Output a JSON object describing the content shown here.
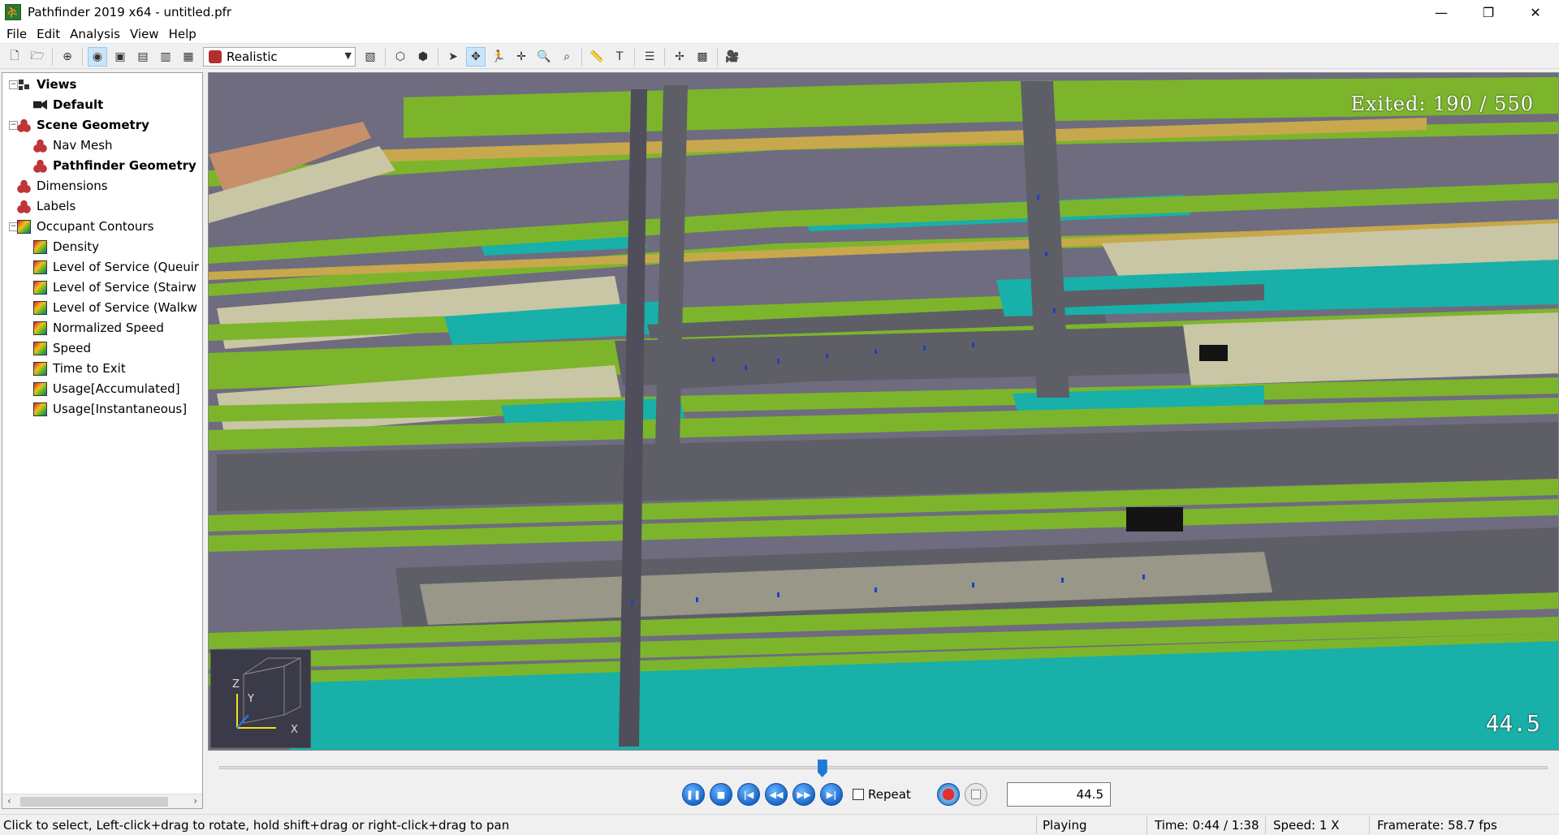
{
  "window": {
    "title": "Pathfinder 2019 x64 - untitled.pfr",
    "app_icon": "pathfinder-runner-icon",
    "minimize": "—",
    "restore": "❐",
    "close": "✕"
  },
  "menu": [
    "File",
    "Edit",
    "Analysis",
    "View",
    "Help"
  ],
  "toolbar": {
    "render_mode": "Realistic"
  },
  "tree": {
    "items": [
      {
        "label": "Views",
        "icon": "views-icon",
        "bold": true
      },
      {
        "label": "Default",
        "icon": "camera-icon",
        "bold": true
      },
      {
        "label": "Scene Geometry",
        "icon": "geometry-icon",
        "bold": true
      },
      {
        "label": "Nav Mesh",
        "icon": "geometry-icon",
        "bold": false
      },
      {
        "label": "Pathfinder Geometry",
        "icon": "geometry-icon",
        "bold": true
      },
      {
        "label": "Dimensions",
        "icon": "geometry-icon",
        "bold": false
      },
      {
        "label": "Labels",
        "icon": "geometry-icon",
        "bold": false
      },
      {
        "label": "Occupant Contours",
        "icon": "contour-icon",
        "bold": false
      },
      {
        "label": "Density",
        "icon": "contour-icon",
        "bold": false
      },
      {
        "label": "Level of Service (Queuir",
        "icon": "contour-icon",
        "bold": false
      },
      {
        "label": "Level of Service (Stairw",
        "icon": "contour-icon",
        "bold": false
      },
      {
        "label": "Level of Service (Walkw",
        "icon": "contour-icon",
        "bold": false
      },
      {
        "label": "Normalized Speed",
        "icon": "contour-icon",
        "bold": false
      },
      {
        "label": "Speed",
        "icon": "contour-icon",
        "bold": false
      },
      {
        "label": "Time to Exit",
        "icon": "contour-icon",
        "bold": false
      },
      {
        "label": "Usage[Accumulated]",
        "icon": "contour-icon",
        "bold": false
      },
      {
        "label": "Usage[Instantaneous]",
        "icon": "contour-icon",
        "bold": false
      }
    ]
  },
  "viewport": {
    "exited_text": "Exited:  190 / 550",
    "time_overlay": "44.5",
    "axes": {
      "z": "Z",
      "y": "Y",
      "x": "X"
    },
    "colors": {
      "background": "#6e6c7e",
      "floor_green": "#7cb52c",
      "floor_dark": "#5e5e66",
      "walls": "#c8c6a4",
      "water": "#18b0a8",
      "corridor_gold": "#c8a84c",
      "stairs_orange": "#c8906a"
    }
  },
  "playback": {
    "progress_fraction": 0.454,
    "buttons": [
      "pause",
      "stop",
      "skip-to-start",
      "step-back",
      "step-forward",
      "skip-to-end"
    ],
    "repeat_label": "Repeat",
    "repeat_checked": false,
    "time_value": "44.5"
  },
  "status": {
    "hint": "Click to select, Left-click+drag to rotate, hold shift+drag or right-click+drag to pan",
    "state": "Playing",
    "time": "Time: 0:44 / 1:38",
    "speed": "Speed: 1 X",
    "framerate": "Framerate: 58.7 fps"
  }
}
